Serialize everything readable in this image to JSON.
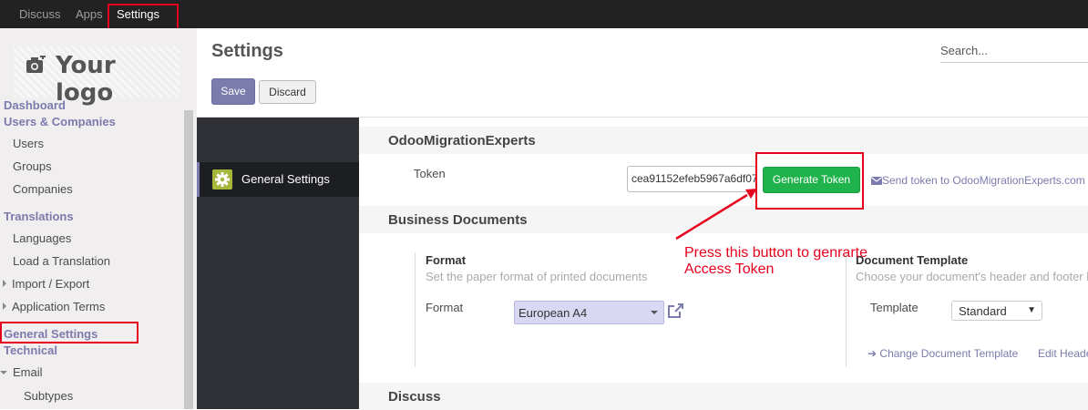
{
  "topbar": {
    "menus": [
      "Discuss",
      "Apps",
      "Settings"
    ]
  },
  "sidebar": {
    "logo_text": "Your logo",
    "items": [
      {
        "label": "Dashboard",
        "type": "head"
      },
      {
        "label": "Users & Companies",
        "type": "head"
      },
      {
        "label": "Users",
        "type": "item"
      },
      {
        "label": "Groups",
        "type": "item"
      },
      {
        "label": "Companies",
        "type": "item"
      },
      {
        "label": "Translations",
        "type": "head"
      },
      {
        "label": "Languages",
        "type": "item"
      },
      {
        "label": "Load a Translation",
        "type": "item"
      },
      {
        "label": "Import / Export",
        "type": "collapsed"
      },
      {
        "label": "Application Terms",
        "type": "collapsed"
      },
      {
        "label": "General Settings",
        "type": "head"
      },
      {
        "label": "Technical",
        "type": "head"
      },
      {
        "label": "Email",
        "type": "expanded"
      },
      {
        "label": "Subtypes",
        "type": "subitem"
      }
    ]
  },
  "control_panel": {
    "title": "Settings",
    "search_placeholder": "Search...",
    "save_label": "Save",
    "discard_label": "Discard"
  },
  "settings_nav": {
    "general_settings_label": "General Settings"
  },
  "sections": {
    "ome": {
      "title": "OdooMigrationExperts",
      "token_label": "Token",
      "token_value": "cea91152efeb5967a6df07",
      "generate_label": "Generate Token",
      "send_link": "Send token to OdooMigrationExperts.com"
    },
    "business": {
      "title": "Business Documents",
      "format_title": "Format",
      "format_desc": "Set the paper format of printed documents",
      "format_label": "Format",
      "format_value": "European A4",
      "doc_template_title": "Document Template",
      "doc_template_desc": "Choose your document's header and footer l",
      "template_label": "Template",
      "template_value": "Standard",
      "change_template_link": "Change Document Template",
      "edit_header_link": "Edit Heade"
    },
    "discuss": {
      "title": "Discuss"
    }
  },
  "annotation": {
    "line1": "Press this button to genrarte",
    "line2": "Access Token",
    "color": "#e6001e"
  }
}
